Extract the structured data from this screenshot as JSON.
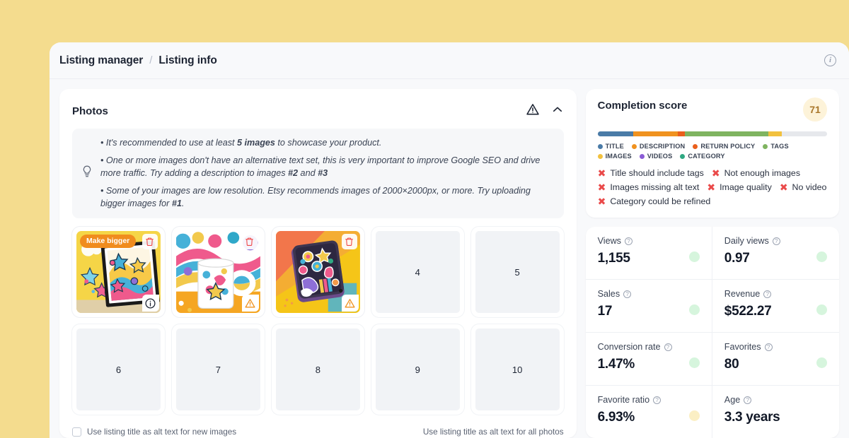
{
  "page": {
    "background_color": "#f4dc8e"
  },
  "topbar": {
    "crumb_root": "Listing manager",
    "crumb_sep": "/",
    "crumb_current": "Listing info",
    "info_icon": "info-circle-icon",
    "info_glyph": "i"
  },
  "photos": {
    "title": "Photos",
    "warning_icon": "warning-triangle-icon",
    "collapse_icon": "chevron-up-icon",
    "tips_icon": "lightbulb-icon",
    "tips": [
      {
        "pre": "• It's recommended to use at least ",
        "bold": "5 images",
        "post": " to showcase your product."
      },
      {
        "pre": "• One or more images don't have an alternative text set, this is very important to improve Google SEO and drive more traffic. Try adding a description to images ",
        "bold": "#2",
        "mid": " and ",
        "bold2": "#3",
        "post": ""
      },
      {
        "pre": "• Some of your images are low resolution. Etsy recommends images of 2000×2000px, or more. Try uploading bigger images for ",
        "bold": "#1",
        "post": "."
      }
    ],
    "slots": [
      {
        "index": "1",
        "filled": true,
        "badge": "Make bigger",
        "trash": true,
        "corner": "info",
        "art": "stars-frame"
      },
      {
        "index": "2",
        "filled": true,
        "badge": "",
        "trash": true,
        "corner": "warning",
        "art": "mug"
      },
      {
        "index": "3",
        "filled": true,
        "badge": "",
        "trash": true,
        "corner": "warning",
        "art": "notebook"
      },
      {
        "index": "4",
        "filled": false,
        "badge": "",
        "trash": false,
        "corner": "",
        "art": ""
      },
      {
        "index": "5",
        "filled": false,
        "badge": "",
        "trash": false,
        "corner": "",
        "art": ""
      },
      {
        "index": "6",
        "filled": false,
        "badge": "",
        "trash": false,
        "corner": "",
        "art": ""
      },
      {
        "index": "7",
        "filled": false,
        "badge": "",
        "trash": false,
        "corner": "",
        "art": ""
      },
      {
        "index": "8",
        "filled": false,
        "badge": "",
        "trash": false,
        "corner": "",
        "art": ""
      },
      {
        "index": "9",
        "filled": false,
        "badge": "",
        "trash": false,
        "corner": "",
        "art": ""
      },
      {
        "index": "10",
        "filled": false,
        "badge": "",
        "trash": false,
        "corner": "",
        "art": ""
      }
    ],
    "alt_checkbox_label": "Use listing title as alt text for new images",
    "alt_checkbox_checked": false,
    "alt_all_label": "Use listing title as alt text for all photos"
  },
  "completion": {
    "title": "Completion score",
    "score": "71",
    "score_badge_bg": "#fdf3d9",
    "score_badge_color": "#a9772b",
    "bar_track_color": "#e6e8ec",
    "segments": [
      {
        "name": "TITLE",
        "color": "#4a7ba7",
        "percent": 15.5
      },
      {
        "name": "DESCRIPTION",
        "color": "#f0921f",
        "percent": 19.5
      },
      {
        "name": "RETURN POLICY",
        "color": "#ea5f1c",
        "percent": 3.0
      },
      {
        "name": "TAGS",
        "color": "#7fb460",
        "percent": 36.5
      },
      {
        "name": "IMAGES",
        "color": "#f2c13e",
        "percent": 5.8
      }
    ],
    "legend": [
      {
        "label": "TITLE",
        "color": "#4a7ba7"
      },
      {
        "label": "DESCRIPTION",
        "color": "#f0921f"
      },
      {
        "label": "RETURN POLICY",
        "color": "#ea5f1c"
      },
      {
        "label": "TAGS",
        "color": "#7fb460"
      },
      {
        "label": "IMAGES",
        "color": "#f2c13e"
      },
      {
        "label": "VIDEOS",
        "color": "#8b5cd6"
      },
      {
        "label": "CATEGORY",
        "color": "#2fa882"
      }
    ],
    "issue_icon": "x-mark-icon",
    "issue_color": "#ea4a4a",
    "issues": [
      "Title should include tags",
      "Not enough images",
      "Images missing alt text",
      "Image quality",
      "No video",
      "Category could be refined"
    ]
  },
  "stats": {
    "help_icon": "question-circle-icon",
    "items": [
      {
        "label": "Views",
        "value": "1,155",
        "dot_color": "#d6f5dd"
      },
      {
        "label": "Daily views",
        "value": "0.97",
        "dot_color": "#d6f5dd"
      },
      {
        "label": "Sales",
        "value": "17",
        "dot_color": "#d6f5dd"
      },
      {
        "label": "Revenue",
        "value": "$522.27",
        "dot_color": "#d6f5dd"
      },
      {
        "label": "Conversion rate",
        "value": "1.47%",
        "dot_color": "#d6f5dd"
      },
      {
        "label": "Favorites",
        "value": "80",
        "dot_color": "#d6f5dd"
      },
      {
        "label": "Favorite ratio",
        "value": "6.93%",
        "dot_color": "#fbefc4"
      },
      {
        "label": "Age",
        "value": "3.3 years",
        "dot_color": "#ffffff"
      }
    ]
  }
}
